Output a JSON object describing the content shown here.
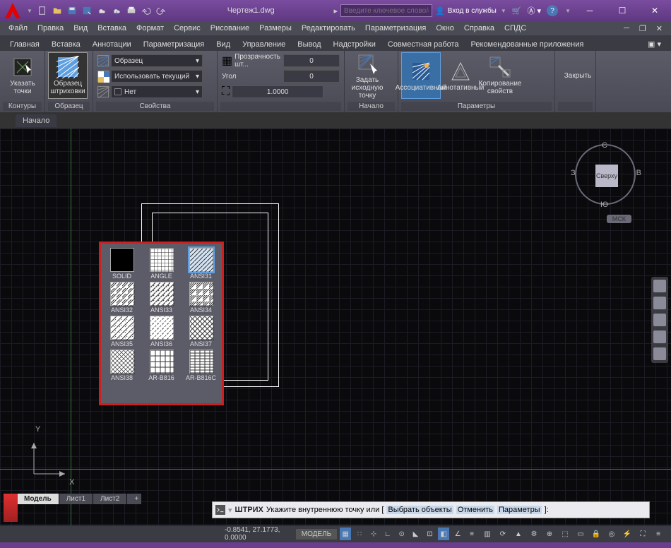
{
  "title": "Чертеж1.dwg",
  "search_placeholder": "Введите ключевое слово/фразу",
  "login": "Вход в службы",
  "menu": [
    "Файл",
    "Правка",
    "Вид",
    "Вставка",
    "Формат",
    "Сервис",
    "Рисование",
    "Размеры",
    "Редактировать",
    "Параметризация",
    "Окно",
    "Справка",
    "СПДС"
  ],
  "tabs": [
    "Главная",
    "Вставка",
    "Аннотации",
    "Параметризация",
    "Вид",
    "Управление",
    "Вывод",
    "Надстройки",
    "Совместная работа",
    "Рекомендованные приложения"
  ],
  "ribbon": {
    "pick_points": "Указать точки",
    "contours": "Контуры",
    "pattern_btn": "Образец штриховки",
    "pattern": "Образец",
    "row1": "Образец",
    "row2": "Использовать текущий",
    "row3": "Нет",
    "prop_title": "Свойства",
    "transp": "Прозрачность шт...",
    "angle": "Угол",
    "transp_val": "0",
    "angle_val": "0",
    "scale_val": "1.0000",
    "origin": "Задать\nисходную точку",
    "origin_panel": "Начало",
    "assoc": "Ассоциативный",
    "annot": "Аннотативный",
    "copy": "Копирование\nсвойств",
    "params": "Параметры",
    "close": "Закрыть"
  },
  "file_tab": "Начало",
  "palette": [
    "SOLID",
    "ANGLE",
    "ANSI31",
    "ANSI32",
    "ANSI33",
    "ANSI34",
    "ANSI35",
    "ANSI36",
    "ANSI37",
    "ANSI38",
    "AR-B816",
    "AR-B816C"
  ],
  "viewcube": {
    "top": "С",
    "left": "З",
    "right": "В",
    "bottom": "Ю",
    "face": "Сверху",
    "wcs": "МСК"
  },
  "cmd": {
    "name": "ШТРИХ",
    "rest": "Укажите внутреннюю точку или [",
    "o1": "Выбрать объекты",
    "o2": "Отменить",
    "o3": "Параметры",
    "end": "]:"
  },
  "layouts": [
    "Модель",
    "Лист1",
    "Лист2"
  ],
  "status": {
    "coords": "-0.8541, 27.1773, 0.0000",
    "model": "МОДЕЛЬ"
  }
}
